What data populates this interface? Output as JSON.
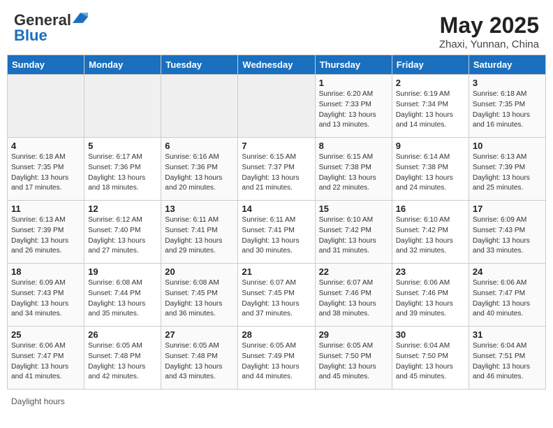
{
  "header": {
    "logo_general": "General",
    "logo_blue": "Blue",
    "month_year": "May 2025",
    "location": "Zhaxi, Yunnan, China"
  },
  "days_of_week": [
    "Sunday",
    "Monday",
    "Tuesday",
    "Wednesday",
    "Thursday",
    "Friday",
    "Saturday"
  ],
  "footer": {
    "label": "Daylight hours"
  },
  "weeks": [
    [
      {
        "day": "",
        "empty": true
      },
      {
        "day": "",
        "empty": true
      },
      {
        "day": "",
        "empty": true
      },
      {
        "day": "",
        "empty": true
      },
      {
        "day": "1",
        "sunrise": "Sunrise: 6:20 AM",
        "sunset": "Sunset: 7:33 PM",
        "daylight": "Daylight: 13 hours and 13 minutes."
      },
      {
        "day": "2",
        "sunrise": "Sunrise: 6:19 AM",
        "sunset": "Sunset: 7:34 PM",
        "daylight": "Daylight: 13 hours and 14 minutes."
      },
      {
        "day": "3",
        "sunrise": "Sunrise: 6:18 AM",
        "sunset": "Sunset: 7:35 PM",
        "daylight": "Daylight: 13 hours and 16 minutes."
      }
    ],
    [
      {
        "day": "4",
        "sunrise": "Sunrise: 6:18 AM",
        "sunset": "Sunset: 7:35 PM",
        "daylight": "Daylight: 13 hours and 17 minutes."
      },
      {
        "day": "5",
        "sunrise": "Sunrise: 6:17 AM",
        "sunset": "Sunset: 7:36 PM",
        "daylight": "Daylight: 13 hours and 18 minutes."
      },
      {
        "day": "6",
        "sunrise": "Sunrise: 6:16 AM",
        "sunset": "Sunset: 7:36 PM",
        "daylight": "Daylight: 13 hours and 20 minutes."
      },
      {
        "day": "7",
        "sunrise": "Sunrise: 6:15 AM",
        "sunset": "Sunset: 7:37 PM",
        "daylight": "Daylight: 13 hours and 21 minutes."
      },
      {
        "day": "8",
        "sunrise": "Sunrise: 6:15 AM",
        "sunset": "Sunset: 7:38 PM",
        "daylight": "Daylight: 13 hours and 22 minutes."
      },
      {
        "day": "9",
        "sunrise": "Sunrise: 6:14 AM",
        "sunset": "Sunset: 7:38 PM",
        "daylight": "Daylight: 13 hours and 24 minutes."
      },
      {
        "day": "10",
        "sunrise": "Sunrise: 6:13 AM",
        "sunset": "Sunset: 7:39 PM",
        "daylight": "Daylight: 13 hours and 25 minutes."
      }
    ],
    [
      {
        "day": "11",
        "sunrise": "Sunrise: 6:13 AM",
        "sunset": "Sunset: 7:39 PM",
        "daylight": "Daylight: 13 hours and 26 minutes."
      },
      {
        "day": "12",
        "sunrise": "Sunrise: 6:12 AM",
        "sunset": "Sunset: 7:40 PM",
        "daylight": "Daylight: 13 hours and 27 minutes."
      },
      {
        "day": "13",
        "sunrise": "Sunrise: 6:11 AM",
        "sunset": "Sunset: 7:41 PM",
        "daylight": "Daylight: 13 hours and 29 minutes."
      },
      {
        "day": "14",
        "sunrise": "Sunrise: 6:11 AM",
        "sunset": "Sunset: 7:41 PM",
        "daylight": "Daylight: 13 hours and 30 minutes."
      },
      {
        "day": "15",
        "sunrise": "Sunrise: 6:10 AM",
        "sunset": "Sunset: 7:42 PM",
        "daylight": "Daylight: 13 hours and 31 minutes."
      },
      {
        "day": "16",
        "sunrise": "Sunrise: 6:10 AM",
        "sunset": "Sunset: 7:42 PM",
        "daylight": "Daylight: 13 hours and 32 minutes."
      },
      {
        "day": "17",
        "sunrise": "Sunrise: 6:09 AM",
        "sunset": "Sunset: 7:43 PM",
        "daylight": "Daylight: 13 hours and 33 minutes."
      }
    ],
    [
      {
        "day": "18",
        "sunrise": "Sunrise: 6:09 AM",
        "sunset": "Sunset: 7:43 PM",
        "daylight": "Daylight: 13 hours and 34 minutes."
      },
      {
        "day": "19",
        "sunrise": "Sunrise: 6:08 AM",
        "sunset": "Sunset: 7:44 PM",
        "daylight": "Daylight: 13 hours and 35 minutes."
      },
      {
        "day": "20",
        "sunrise": "Sunrise: 6:08 AM",
        "sunset": "Sunset: 7:45 PM",
        "daylight": "Daylight: 13 hours and 36 minutes."
      },
      {
        "day": "21",
        "sunrise": "Sunrise: 6:07 AM",
        "sunset": "Sunset: 7:45 PM",
        "daylight": "Daylight: 13 hours and 37 minutes."
      },
      {
        "day": "22",
        "sunrise": "Sunrise: 6:07 AM",
        "sunset": "Sunset: 7:46 PM",
        "daylight": "Daylight: 13 hours and 38 minutes."
      },
      {
        "day": "23",
        "sunrise": "Sunrise: 6:06 AM",
        "sunset": "Sunset: 7:46 PM",
        "daylight": "Daylight: 13 hours and 39 minutes."
      },
      {
        "day": "24",
        "sunrise": "Sunrise: 6:06 AM",
        "sunset": "Sunset: 7:47 PM",
        "daylight": "Daylight: 13 hours and 40 minutes."
      }
    ],
    [
      {
        "day": "25",
        "sunrise": "Sunrise: 6:06 AM",
        "sunset": "Sunset: 7:47 PM",
        "daylight": "Daylight: 13 hours and 41 minutes."
      },
      {
        "day": "26",
        "sunrise": "Sunrise: 6:05 AM",
        "sunset": "Sunset: 7:48 PM",
        "daylight": "Daylight: 13 hours and 42 minutes."
      },
      {
        "day": "27",
        "sunrise": "Sunrise: 6:05 AM",
        "sunset": "Sunset: 7:48 PM",
        "daylight": "Daylight: 13 hours and 43 minutes."
      },
      {
        "day": "28",
        "sunrise": "Sunrise: 6:05 AM",
        "sunset": "Sunset: 7:49 PM",
        "daylight": "Daylight: 13 hours and 44 minutes."
      },
      {
        "day": "29",
        "sunrise": "Sunrise: 6:05 AM",
        "sunset": "Sunset: 7:50 PM",
        "daylight": "Daylight: 13 hours and 45 minutes."
      },
      {
        "day": "30",
        "sunrise": "Sunrise: 6:04 AM",
        "sunset": "Sunset: 7:50 PM",
        "daylight": "Daylight: 13 hours and 45 minutes."
      },
      {
        "day": "31",
        "sunrise": "Sunrise: 6:04 AM",
        "sunset": "Sunset: 7:51 PM",
        "daylight": "Daylight: 13 hours and 46 minutes."
      }
    ]
  ]
}
